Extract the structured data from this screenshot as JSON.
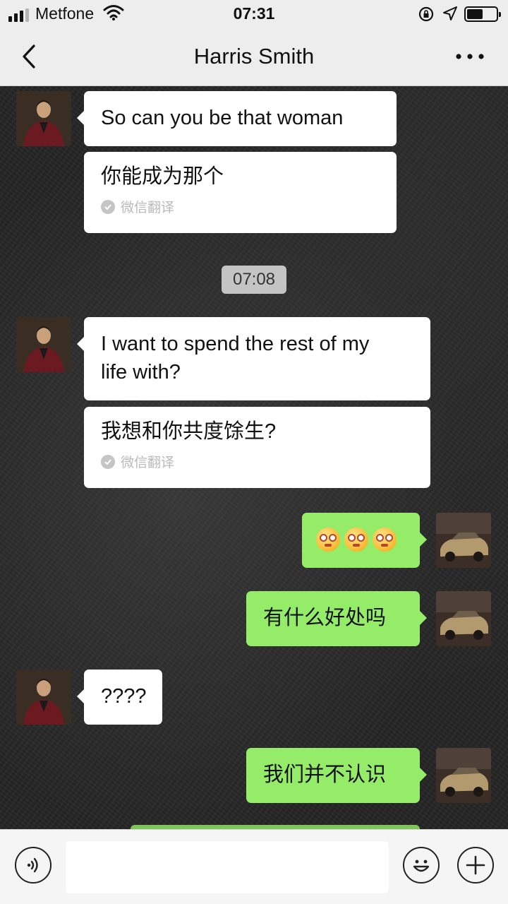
{
  "status_bar": {
    "carrier": "Metfone",
    "time": "07:31",
    "battery_level_fraction": 0.5,
    "icons": [
      "signal-icon",
      "wifi-icon",
      "orientation-lock-icon",
      "location-arrow-icon",
      "battery-icon"
    ]
  },
  "header": {
    "title": "Harris Smith",
    "back_icon": "chevron-left-icon",
    "more_icon": "more-dots-icon"
  },
  "messages": [
    {
      "from": "contact",
      "text": "So can you be that woman",
      "translation": "你能成为那个",
      "translation_label": "微信翻译"
    },
    {
      "type": "timestamp",
      "text": "07:08"
    },
    {
      "from": "contact",
      "text_line1": "I want to spend the rest of my",
      "text_line2": "life with?",
      "translation": "我想和你共度馀生?",
      "translation_label": "微信翻译"
    },
    {
      "from": "me",
      "emoji": [
        "dizzy-face-icon",
        "dizzy-face-icon",
        "dizzy-face-icon"
      ]
    },
    {
      "from": "me",
      "text": "有什么好处吗"
    },
    {
      "from": "contact",
      "text": "????"
    },
    {
      "from": "me",
      "text": "我们并不认识"
    }
  ],
  "input_bar": {
    "voice_icon": "voice-icon",
    "emoji_icon": "smiley-icon",
    "plus_icon": "plus-icon",
    "value": ""
  },
  "colors": {
    "outgoing_bubble": "#95ec69",
    "incoming_bubble": "#ffffff",
    "header_bg": "#ededed",
    "timestamp_bg": "#c4c4c4"
  }
}
